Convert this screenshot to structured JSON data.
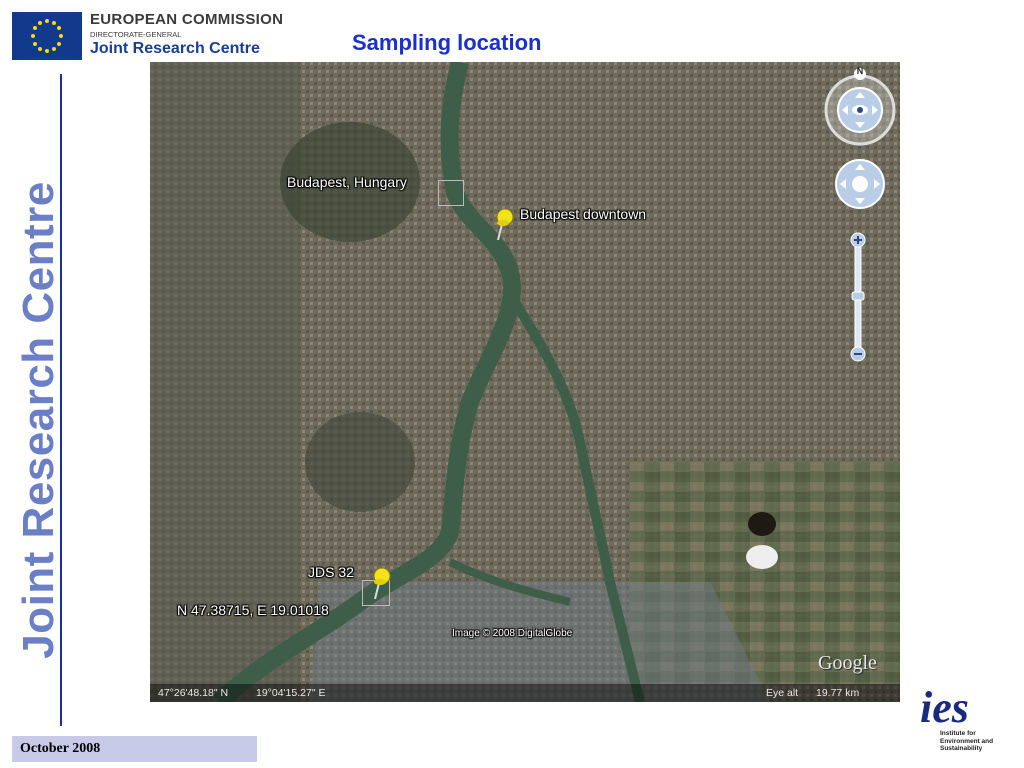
{
  "header": {
    "org_line1": "EUROPEAN COMMISSION",
    "org_line2": "DIRECTORATE-GENERAL",
    "org_line3": "Joint Research Centre",
    "title": "Sampling location"
  },
  "sidebar": {
    "vertical_label": "Joint Research Centre"
  },
  "map": {
    "labels": {
      "city": "Budapest, Hungary",
      "downtown": "Budapest downtown",
      "site": "JDS 32",
      "site_coords": "N 47.38715, E 19.01018",
      "imagery_credit": "Image © 2008 DigitalGlobe",
      "provider": "Google"
    },
    "status": {
      "latitude": "47°26'48.18\" N",
      "longitude": "19°04'15.27\" E",
      "eye_alt_label": "Eye alt",
      "eye_alt_value": "19.77 km"
    },
    "compass_letter": "N",
    "colors": {
      "river": "#3f5e4a",
      "pin": "#f2e21a"
    }
  },
  "footer": {
    "date": "October 2008",
    "logo_mark": "ies",
    "logo_text": "Institute for Environment and Sustainability"
  }
}
